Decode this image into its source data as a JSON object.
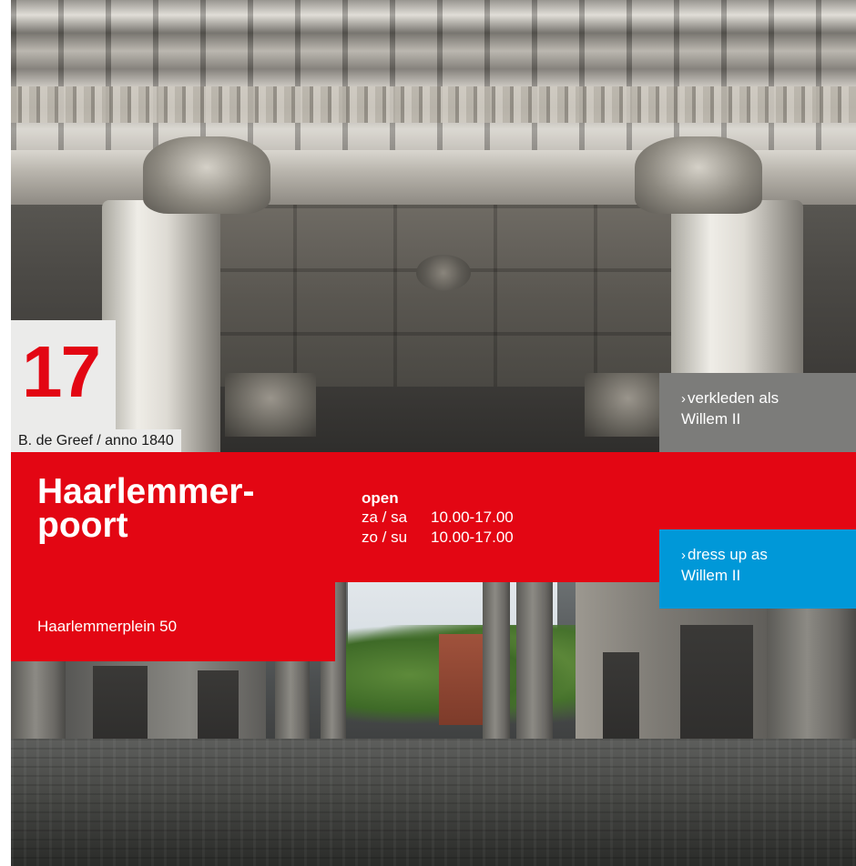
{
  "entry": {
    "number": "17",
    "credit": "B. de Greef / anno 1840",
    "title_line1": "Haarlemmer-",
    "title_line2": "poort",
    "address": "Haarlemmerplein 50"
  },
  "hours": {
    "title": "open",
    "rows": [
      {
        "day": "za / sa",
        "time": "10.00-17.00"
      },
      {
        "day": "zo / su",
        "time": "10.00-17.00"
      }
    ]
  },
  "activities": {
    "dutch": {
      "caret": "›",
      "line1": "verkleden als",
      "line2": "Willem II"
    },
    "english": {
      "caret": "›",
      "line1": "dress up as",
      "line2": "Willem II"
    }
  },
  "colors": {
    "accent_red": "#e30613",
    "accent_blue": "#0098d8",
    "tag_gray": "#7c7c7a",
    "number_box": "#ebebea"
  }
}
